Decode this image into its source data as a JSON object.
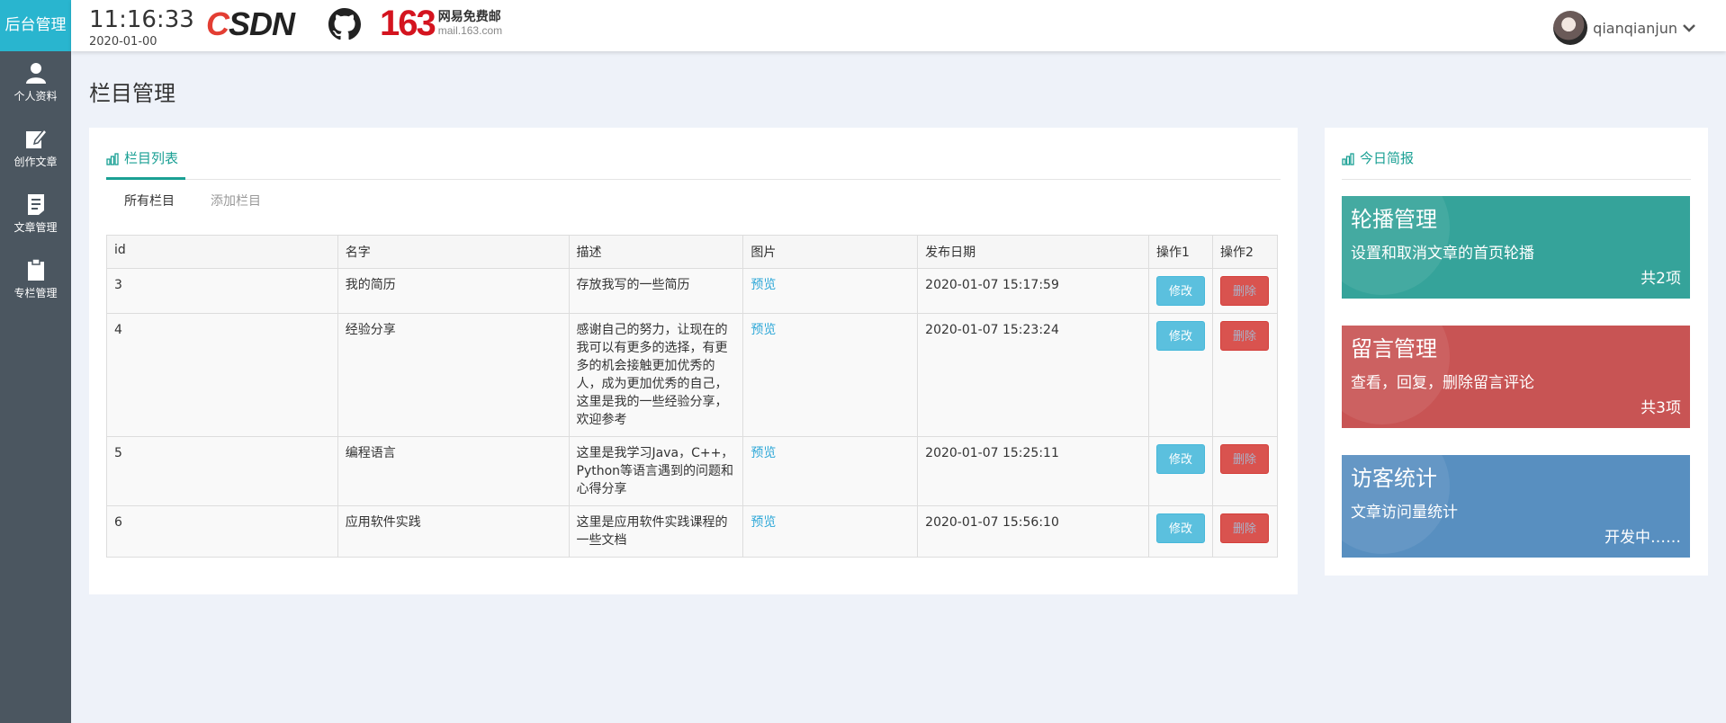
{
  "brand": "后台管理",
  "header": {
    "time": "11:16:33",
    "date": "2020-01-00",
    "logo_csdn_c": "C",
    "logo_csdn_rest": "SDN",
    "logo_163_num": "163",
    "logo_163_title": "网易免费邮",
    "logo_163_domain": "mail.163.com",
    "username": "qianqianjun",
    "caret": "⌄"
  },
  "sidebar": {
    "items": [
      {
        "label": "个人资料",
        "icon": "user-icon"
      },
      {
        "label": "创作文章",
        "icon": "edit-icon"
      },
      {
        "label": "文章管理",
        "icon": "document-icon"
      },
      {
        "label": "专栏管理",
        "icon": "clipboard-icon"
      }
    ]
  },
  "page_title": "栏目管理",
  "list_panel": {
    "title": "栏目列表",
    "tabs": [
      "所有栏目",
      "添加栏目"
    ],
    "columns": [
      "id",
      "名字",
      "描述",
      "图片",
      "发布日期",
      "操作1",
      "操作2"
    ],
    "rows": [
      {
        "id": "3",
        "name": "我的简历",
        "desc": "存放我写的一些简历",
        "image": "预览",
        "date": "2020-01-07 15:17:59",
        "edit": "修改",
        "del": "删除"
      },
      {
        "id": "4",
        "name": "经验分享",
        "desc": "感谢自己的努力，让现在的我可以有更多的选择，有更多的机会接触更加优秀的人，成为更加优秀的自己，这里是我的一些经验分享，欢迎参考",
        "image": "预览",
        "date": "2020-01-07 15:23:24",
        "edit": "修改",
        "del": "删除"
      },
      {
        "id": "5",
        "name": "编程语言",
        "desc": "这里是我学习Java，C++，Python等语言遇到的问题和心得分享",
        "image": "预览",
        "date": "2020-01-07 15:25:11",
        "edit": "修改",
        "del": "删除"
      },
      {
        "id": "6",
        "name": "应用软件实践",
        "desc": "这里是应用软件实践课程的一些文档",
        "image": "预览",
        "date": "2020-01-07 15:56:10",
        "edit": "修改",
        "del": "删除"
      }
    ]
  },
  "side_panel": {
    "title": "今日简报",
    "cards": [
      {
        "title": "轮播管理",
        "desc": "设置和取消文章的首页轮播",
        "count": "共2项",
        "color": "#35a39a"
      },
      {
        "title": "留言管理",
        "desc": "查看，回复，删除留言评论",
        "count": "共3项",
        "color": "#c85454"
      },
      {
        "title": "访客统计",
        "desc": "文章访问量统计",
        "count": "开发中……",
        "color": "#588fc0"
      }
    ]
  },
  "colors": {
    "accent": "#1aa094",
    "brand_bg": "#29b5cf",
    "sidebar_bg": "#4b5660",
    "link": "#2fa8d8"
  }
}
